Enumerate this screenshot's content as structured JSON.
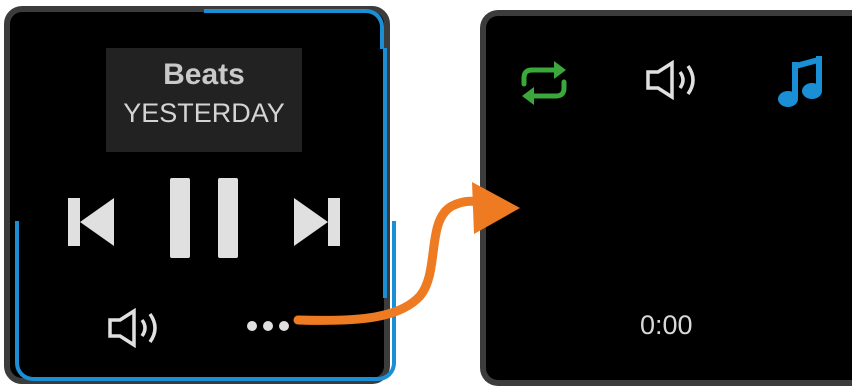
{
  "player": {
    "track_title": "Beats",
    "artist": "YESTERDAY",
    "prev_icon": "skip-previous-icon",
    "pause_icon": "pause-icon",
    "next_icon": "skip-next-icon",
    "volume_icon": "speaker-icon",
    "more_icon": "more-options-icon"
  },
  "options": {
    "repeat_icon": "repeat-icon",
    "volume_icon": "speaker-icon",
    "music_icon": "music-note-icon",
    "elapsed_time": "0:00"
  },
  "colors": {
    "accent_blue": "#1a8fd6",
    "arrow_orange": "#ee7a22",
    "repeat_green": "#3aa83a",
    "icon_light": "#e0e0e0"
  }
}
